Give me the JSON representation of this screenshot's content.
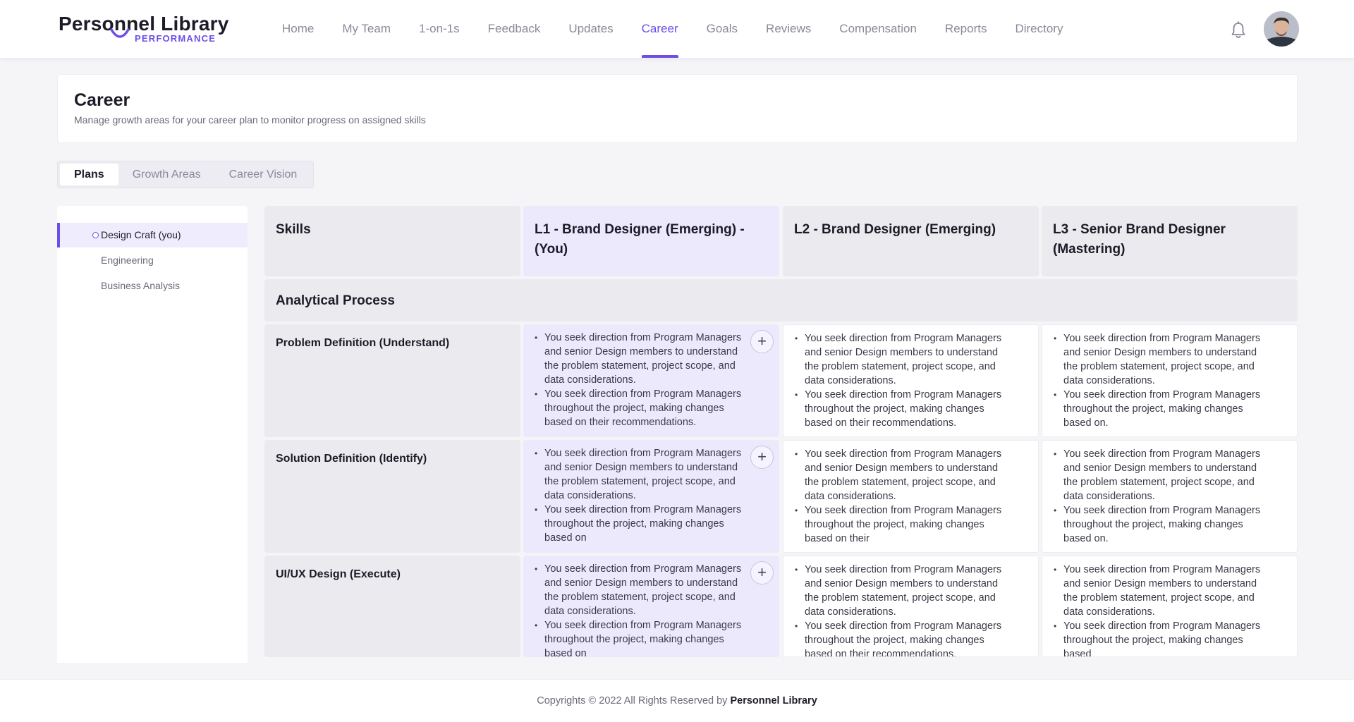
{
  "brand": {
    "name": "Personnel Library",
    "sub": "PERFORMANCE",
    "accent": "#6d4ee6"
  },
  "nav": {
    "items": [
      {
        "label": "Home"
      },
      {
        "label": "My Team"
      },
      {
        "label": "1-on-1s"
      },
      {
        "label": "Feedback"
      },
      {
        "label": "Updates"
      },
      {
        "label": "Career"
      },
      {
        "label": "Goals"
      },
      {
        "label": "Reviews"
      },
      {
        "label": "Compensation"
      },
      {
        "label": "Reports"
      },
      {
        "label": "Directory"
      }
    ],
    "active": "Career",
    "bell_icon": "bell-icon",
    "avatar_icon": "user-avatar"
  },
  "header": {
    "title": "Career",
    "subtitle": "Manage growth areas for your career plan to monitor progress on assigned skills"
  },
  "tabs": {
    "items": [
      {
        "label": "Plans"
      },
      {
        "label": "Growth Areas"
      },
      {
        "label": "Career Vision"
      }
    ],
    "active": "Plans"
  },
  "sidebar": {
    "items": [
      {
        "label": "Design Craft (you)"
      },
      {
        "label": "Engineering"
      },
      {
        "label": "Business Analysis"
      }
    ],
    "active": "Design Craft (you)"
  },
  "grid": {
    "columns": [
      {
        "label": "Skills"
      },
      {
        "label": "L1 - Brand Designer (Emerging) - (You)"
      },
      {
        "label": "L2 - Brand Designer (Emerging)"
      },
      {
        "label": "L3 - Senior Brand Designer (Mastering)"
      }
    ],
    "section": "Analytical Process",
    "rows": [
      {
        "skill": "Problem Definition (Understand)",
        "l1": [
          "You seek direction from Program Managers and senior Design members to understand the problem statement, project scope, and data considerations.",
          "You seek direction from Program Managers throughout the project, making changes based on their recommendations."
        ],
        "l2": [
          "You seek direction from Program Managers and senior Design members to understand the problem statement, project scope, and data considerations.",
          "You seek direction from Program Managers throughout the project, making changes based on their recommendations."
        ],
        "l3": [
          "You seek direction from Program Managers and senior Design members to understand the problem statement, project scope, and data considerations.",
          "You seek direction from Program Managers throughout the project, making changes based on."
        ]
      },
      {
        "skill": "Solution Definition (Identify)",
        "l1": [
          "You seek direction from Program Managers and senior Design members to understand the problem statement, project scope, and data considerations.",
          "You seek direction from Program Managers throughout the project, making changes based on"
        ],
        "l2": [
          "You seek direction from Program Managers and senior Design members to understand the problem statement, project scope, and data considerations.",
          "You seek direction from Program Managers throughout the project, making changes based on their"
        ],
        "l3": [
          "You seek direction from Program Managers and senior Design members to understand the problem statement, project scope, and data considerations.",
          "You seek direction from Program Managers throughout the project, making changes based on."
        ]
      },
      {
        "skill": "UI/UX Design (Execute)",
        "l1": [
          "You seek direction from Program Managers and senior Design members to understand the problem statement, project scope, and data considerations.",
          "You seek direction from Program Managers throughout the project, making changes based on"
        ],
        "l2": [
          "You seek direction from Program Managers and senior Design members to understand the problem statement, project scope, and data considerations.",
          "You seek direction from Program Managers throughout the project, making changes based on their recommendations."
        ],
        "l3": [
          "You seek direction from Program Managers and senior Design members to understand the problem statement, project scope, and data considerations.",
          "You seek direction from Program Managers throughout the project, making changes based"
        ]
      }
    ],
    "add_icon": "plus-icon"
  },
  "footer": {
    "prefix": "Copyrights © 2022 All Rights Reserved by",
    "brand": "Personnel Library"
  }
}
